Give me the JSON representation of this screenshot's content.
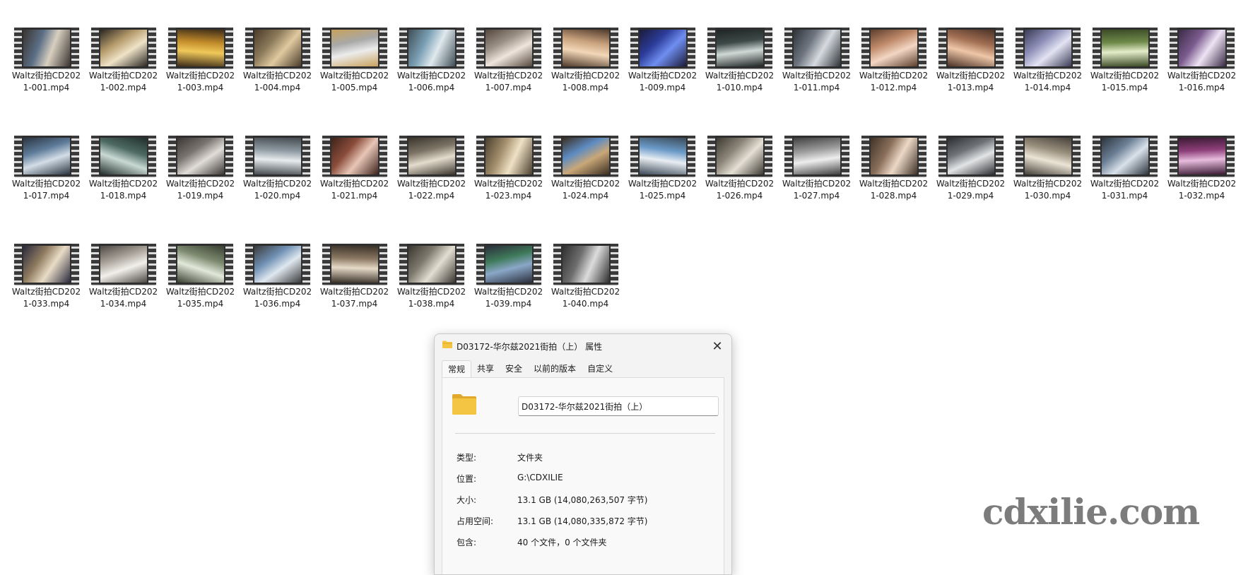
{
  "files": [
    {
      "name": "Waltz街拍CD2021-001.mp4",
      "thumb": [
        "#5b6f86",
        "#d8cfc0",
        "#3a3430"
      ]
    },
    {
      "name": "Waltz街拍CD2021-002.mp4",
      "thumb": [
        "#b59a6b",
        "#efe3c7",
        "#2a2622"
      ]
    },
    {
      "name": "Waltz街拍CD2021-003.mp4",
      "thumb": [
        "#c28b2a",
        "#f0c85a",
        "#3d2c18"
      ]
    },
    {
      "name": "Waltz街拍CD2021-004.mp4",
      "thumb": [
        "#8c7a5a",
        "#e0c9a0",
        "#4a3b2a"
      ]
    },
    {
      "name": "Waltz街拍CD2021-005.mp4",
      "thumb": [
        "#a8a8a8",
        "#ececec",
        "#c8a15b"
      ]
    },
    {
      "name": "Waltz街拍CD2021-006.mp4",
      "thumb": [
        "#7a9fb4",
        "#dfe9ee",
        "#3f4e56"
      ]
    },
    {
      "name": "Waltz街拍CD2021-007.mp4",
      "thumb": [
        "#9b9187",
        "#efe5dc",
        "#54463d"
      ]
    },
    {
      "name": "Waltz街拍CD2021-008.mp4",
      "thumb": [
        "#c9a27d",
        "#f2d7b8",
        "#4f3a2b"
      ]
    },
    {
      "name": "Waltz街拍CD2021-009.mp4",
      "thumb": [
        "#2c3c9a",
        "#6f8ef0",
        "#1b1b3a"
      ]
    },
    {
      "name": "Waltz街拍CD2021-010.mp4",
      "thumb": [
        "#3d4a48",
        "#cfd9d6",
        "#1f2424"
      ]
    },
    {
      "name": "Waltz街拍CD2021-011.mp4",
      "thumb": [
        "#6f7680",
        "#d7dbe0",
        "#2e3338"
      ]
    },
    {
      "name": "Waltz街拍CD2021-012.mp4",
      "thumb": [
        "#c08a6a",
        "#f3d6c3",
        "#5c3e2d"
      ]
    },
    {
      "name": "Waltz街拍CD2021-013.mp4",
      "thumb": [
        "#a26f53",
        "#efc7a8",
        "#4a3126"
      ]
    },
    {
      "name": "Waltz街拍CD2021-014.mp4",
      "thumb": [
        "#8d8fb8",
        "#e3e3f3",
        "#3a3b55"
      ]
    },
    {
      "name": "Waltz街拍CD2021-015.mp4",
      "thumb": [
        "#6f8a4a",
        "#e4ecc9",
        "#3b4a26"
      ]
    },
    {
      "name": "Waltz街拍CD2021-016.mp4",
      "thumb": [
        "#7b5b8e",
        "#eee3f4",
        "#3a2b45"
      ]
    },
    {
      "name": "Waltz街拍CD2021-017.mp4",
      "thumb": [
        "#5e7c9a",
        "#d3dde7",
        "#2a3440"
      ]
    },
    {
      "name": "Waltz街拍CD2021-018.mp4",
      "thumb": [
        "#4d6a62",
        "#c9d9d4",
        "#222e2b"
      ]
    },
    {
      "name": "Waltz街拍CD2021-019.mp4",
      "thumb": [
        "#7a7470",
        "#e1ddd9",
        "#3a3634"
      ]
    },
    {
      "name": "Waltz街拍CD2021-020.mp4",
      "thumb": [
        "#8e9aa2",
        "#e8ecee",
        "#454b50"
      ]
    },
    {
      "name": "Waltz街拍CD2021-021.mp4",
      "thumb": [
        "#8a4c3a",
        "#e8c6b7",
        "#3e231b"
      ]
    },
    {
      "name": "Waltz街拍CD2021-022.mp4",
      "thumb": [
        "#7d7466",
        "#e4dccd",
        "#3a342c"
      ]
    },
    {
      "name": "Waltz街拍CD2021-023.mp4",
      "thumb": [
        "#a48f6d",
        "#efe1c5",
        "#4a3f2e"
      ]
    },
    {
      "name": "Waltz街拍CD2021-024.mp4",
      "thumb": [
        "#5d8bc2",
        "#c9a778",
        "#3a2e22"
      ]
    },
    {
      "name": "Waltz街拍CD2021-025.mp4",
      "thumb": [
        "#6a9ac8",
        "#e9eef3",
        "#3b4a58"
      ]
    },
    {
      "name": "Waltz街拍CD2021-026.mp4",
      "thumb": [
        "#8b8578",
        "#e5e0d5",
        "#3d3a33"
      ]
    },
    {
      "name": "Waltz街拍CD2021-027.mp4",
      "thumb": [
        "#9a9a9a",
        "#eeeeee",
        "#404040"
      ]
    },
    {
      "name": "Waltz街拍CD2021-028.mp4",
      "thumb": [
        "#8a6f5a",
        "#ecd8c6",
        "#3f3228"
      ]
    },
    {
      "name": "Waltz街拍CD2021-029.mp4",
      "thumb": [
        "#6f7378",
        "#e2e4e6",
        "#2c2e31"
      ]
    },
    {
      "name": "Waltz街拍CD2021-030.mp4",
      "thumb": [
        "#9a8f7d",
        "#ece5d6",
        "#45403a"
      ]
    },
    {
      "name": "Waltz街拍CD2021-031.mp4",
      "thumb": [
        "#6b7f95",
        "#d9e1ea",
        "#2c343d"
      ]
    },
    {
      "name": "Waltz街拍CD2021-032.mp4",
      "thumb": [
        "#8e3f7a",
        "#e7bcdd",
        "#3a1a33"
      ]
    },
    {
      "name": "Waltz街拍CD2021-033.mp4",
      "thumb": [
        "#8e7a5e",
        "#e9dcc6",
        "#2a2a3e"
      ]
    },
    {
      "name": "Waltz街拍CD2021-034.mp4",
      "thumb": [
        "#a9a39a",
        "#f2f0ec",
        "#4c4842"
      ]
    },
    {
      "name": "Waltz街拍CD2021-035.mp4",
      "thumb": [
        "#7c8a6f",
        "#e2e8da",
        "#383f31"
      ]
    },
    {
      "name": "Waltz街拍CD2021-036.mp4",
      "thumb": [
        "#6f8fb3",
        "#dfe7ef",
        "#3a3a3a"
      ]
    },
    {
      "name": "Waltz街拍CD2021-037.mp4",
      "thumb": [
        "#8a7862",
        "#e6dac8",
        "#3a3128"
      ]
    },
    {
      "name": "Waltz街拍CD2021-038.mp4",
      "thumb": [
        "#7f7a6e",
        "#e2ded2",
        "#393630"
      ]
    },
    {
      "name": "Waltz街拍CD2021-039.mp4",
      "thumb": [
        "#3f7a5a",
        "#8aa7c8",
        "#2a2e3a"
      ]
    },
    {
      "name": "Waltz街拍CD2021-040.mp4",
      "thumb": [
        "#6e6e6e",
        "#dcdcdc",
        "#2e2e2e"
      ]
    }
  ],
  "dialog": {
    "title": "D03172-华尔兹2021街拍（上）  属性",
    "close_glyph": "✕",
    "tabs": [
      "常规",
      "共享",
      "安全",
      "以前的版本",
      "自定义"
    ],
    "folder_name": "D03172-华尔兹2021街拍（上）",
    "properties": [
      {
        "label": "类型:",
        "value": "文件夹"
      },
      {
        "label": "位置:",
        "value": "G:\\CDXILIE"
      },
      {
        "label": "大小:",
        "value": "13.1 GB (14,080,263,507 字节)"
      },
      {
        "label": "占用空间:",
        "value": "13.1 GB (14,080,335,872 字节)"
      },
      {
        "label": "包含:",
        "value": "40 个文件，0 个文件夹"
      }
    ]
  },
  "watermark": "cdxilie.com",
  "colors": {
    "folder_yellow": "#f4c542",
    "folder_shade": "#e0a92b"
  }
}
